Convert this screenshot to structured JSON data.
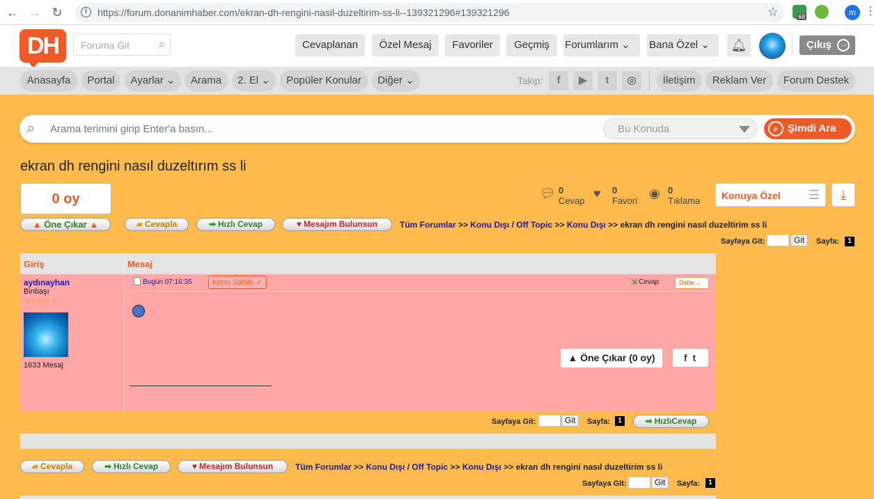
{
  "browser": {
    "url": "https://forum.donanimhaber.com/ekran-dh-rengini-nasil-duzeltirim-ss-li--139321296#139321296",
    "ext_badge": "68",
    "profile_initial": "m"
  },
  "header": {
    "logo": "DH",
    "goto_placeholder": "Foruma Git",
    "nav": [
      "Cevaplanan",
      "Özel Mesaj",
      "Favoriler",
      "Geçmiş",
      "Forumlarım",
      "Bana Özel"
    ],
    "logout": "Çıkış"
  },
  "subnav": {
    "items": [
      "Anasayfa",
      "Portal",
      "Ayarlar",
      "Arama",
      "2. El",
      "Popüler Konular",
      "Diğer"
    ],
    "follow_label": "Takip:",
    "right": [
      "İletişim",
      "Reklam Ver",
      "Forum Destek"
    ]
  },
  "search": {
    "placeholder": "Arama terimini girip Enter'a basın...",
    "scope": "Bu Konuda",
    "button": "Şimdi Ara"
  },
  "topic": {
    "title": "ekran dh rengini nasıl duzeltırım ss li",
    "votes": "0 oy",
    "stats": [
      {
        "num": "0",
        "label": "Cevap"
      },
      {
        "num": "0",
        "label": "Favori"
      },
      {
        "num": "0",
        "label": "Tıklama"
      }
    ],
    "special": "Konuya Özel"
  },
  "actions": {
    "promote": "Öne Çıkar",
    "reply": "Cevapla",
    "quick_reply": "Hızlı Cevap",
    "find_msg": "Mesajım Bulunsun"
  },
  "breadcrumb": {
    "all": "Tüm Forumlar",
    "sep": ">>",
    "cat1": "Konu Dışı / Off Topic",
    "cat2": "Konu Dışı",
    "current": "ekran dh rengini nasıl duzeltirim ss li"
  },
  "paging": {
    "goto": "Sayfaya Git:",
    "go": "Git",
    "page_label": "Sayfa:",
    "page": "1"
  },
  "table": {
    "col_login": "Giriş",
    "col_message": "Mesaj"
  },
  "post": {
    "author": "aydınayhan",
    "rank": "Binbaşı",
    "stars": "☆☆☆☆☆",
    "msg_count": "1633 Mesaj",
    "time": "Bugün 07:16:35",
    "owner_badge": "Konu Sahibi",
    "reply": "Cevap",
    "more": "Daha",
    "promote": "Öne Çıkar (0 oy)",
    "quick_reply_bottom": "HızlıCevap"
  }
}
